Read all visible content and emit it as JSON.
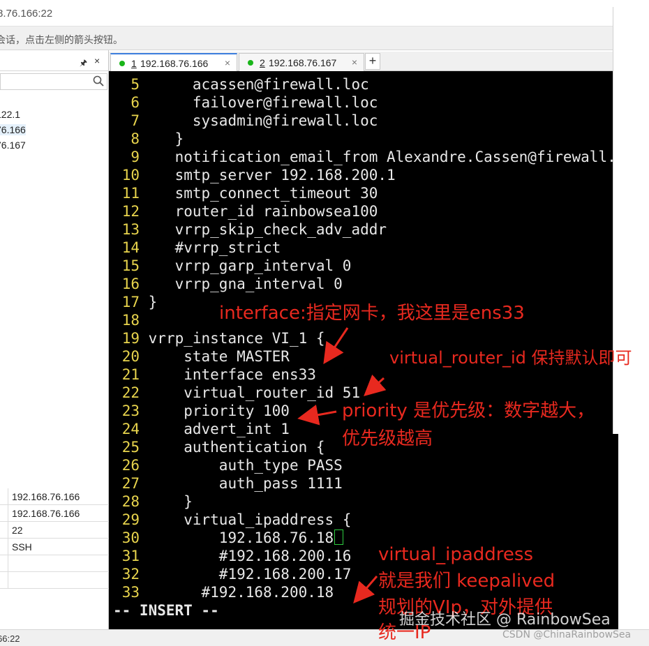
{
  "window": {
    "title": "8.76.166:22",
    "hint": "会话，点击左侧的箭头按钮。"
  },
  "left_panel": {
    "pin_icon": "pin-icon",
    "close_label": "×",
    "tree": [
      "122.1",
      "76.166",
      "76.167"
    ],
    "props": [
      "192.168.76.166",
      "192.168.76.166",
      "22",
      "SSH",
      "",
      ""
    ]
  },
  "status_bar": {
    "text": "66:22"
  },
  "tabs": [
    {
      "num": "1",
      "label": " 192.168.76.166",
      "active": true
    },
    {
      "num": "2",
      "label": " 192.168.76.167",
      "active": false
    }
  ],
  "tab_close": "×",
  "tab_add": "+",
  "terminal": {
    "lines": [
      {
        "n": "5",
        "t": "     acassen@firewall.loc"
      },
      {
        "n": "6",
        "t": "     failover@firewall.loc"
      },
      {
        "n": "7",
        "t": "     sysadmin@firewall.loc"
      },
      {
        "n": "8",
        "t": "   }"
      },
      {
        "n": "9",
        "t": "   notification_email_from Alexandre.Cassen@firewall.loc"
      },
      {
        "n": "10",
        "t": "   smtp_server 192.168.200.1"
      },
      {
        "n": "11",
        "t": "   smtp_connect_timeout 30"
      },
      {
        "n": "12",
        "t": "   router_id rainbowsea100"
      },
      {
        "n": "13",
        "t": "   vrrp_skip_check_adv_addr"
      },
      {
        "n": "14",
        "t": "   #vrrp_strict"
      },
      {
        "n": "15",
        "t": "   vrrp_garp_interval 0"
      },
      {
        "n": "16",
        "t": "   vrrp_gna_interval 0"
      },
      {
        "n": "17",
        "t": "}"
      },
      {
        "n": "18",
        "t": ""
      },
      {
        "n": "19",
        "t": "vrrp_instance VI_1 {"
      },
      {
        "n": "20",
        "t": "    state MASTER"
      },
      {
        "n": "21",
        "t": "    interface ens33"
      },
      {
        "n": "22",
        "t": "    virtual_router_id 51"
      },
      {
        "n": "23",
        "t": "    priority 100"
      },
      {
        "n": "24",
        "t": "    advert_int 1"
      },
      {
        "n": "25",
        "t": "    authentication {"
      },
      {
        "n": "26",
        "t": "        auth_type PASS"
      },
      {
        "n": "27",
        "t": "        auth_pass 1111"
      },
      {
        "n": "28",
        "t": "    }"
      },
      {
        "n": "29",
        "t": "    virtual_ipaddress {"
      },
      {
        "n": "30",
        "t": "        192.168.76.18"
      },
      {
        "n": "31",
        "t": "        #192.168.200.16"
      },
      {
        "n": "32",
        "t": "        #192.168.200.17"
      },
      {
        "n": "33",
        "t": "      #192.168.200.18"
      }
    ],
    "mode": "-- INSERT --"
  },
  "annotations": {
    "interface": "interface:指定网卡，我这里是ens33",
    "router_id": "virtual_router_id 保持默认即可",
    "priority_1": "priority 是优先级：数字越大，",
    "priority_2": "优先级越高",
    "vip_1": "virtual_ipaddress",
    "vip_2": "就是我们 keepalived",
    "vip_3": "规划的VIp，对外提供",
    "vip_4": "统一IP"
  },
  "watermarks": {
    "juejin": "掘金技术社区 @ RainbowSea",
    "csdn": "CSDN @ChinaRainbowSea"
  },
  "colors": {
    "terminal_bg": "#000000",
    "line_number": "#e8d44d",
    "annotation": "#e8291f",
    "tab_dot": "#19b519",
    "cursor": "#2ecc40"
  }
}
